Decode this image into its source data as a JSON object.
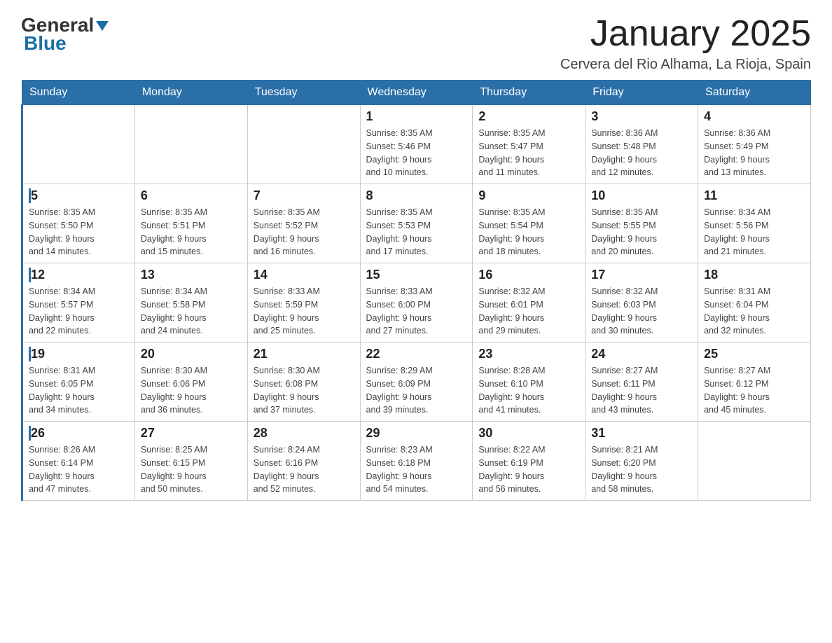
{
  "header": {
    "logo_main": "General",
    "logo_sub": "Blue",
    "month": "January 2025",
    "location": "Cervera del Rio Alhama, La Rioja, Spain"
  },
  "days_of_week": [
    "Sunday",
    "Monday",
    "Tuesday",
    "Wednesday",
    "Thursday",
    "Friday",
    "Saturday"
  ],
  "weeks": [
    [
      {
        "day": "",
        "info": ""
      },
      {
        "day": "",
        "info": ""
      },
      {
        "day": "",
        "info": ""
      },
      {
        "day": "1",
        "info": "Sunrise: 8:35 AM\nSunset: 5:46 PM\nDaylight: 9 hours\nand 10 minutes."
      },
      {
        "day": "2",
        "info": "Sunrise: 8:35 AM\nSunset: 5:47 PM\nDaylight: 9 hours\nand 11 minutes."
      },
      {
        "day": "3",
        "info": "Sunrise: 8:36 AM\nSunset: 5:48 PM\nDaylight: 9 hours\nand 12 minutes."
      },
      {
        "day": "4",
        "info": "Sunrise: 8:36 AM\nSunset: 5:49 PM\nDaylight: 9 hours\nand 13 minutes."
      }
    ],
    [
      {
        "day": "5",
        "info": "Sunrise: 8:35 AM\nSunset: 5:50 PM\nDaylight: 9 hours\nand 14 minutes."
      },
      {
        "day": "6",
        "info": "Sunrise: 8:35 AM\nSunset: 5:51 PM\nDaylight: 9 hours\nand 15 minutes."
      },
      {
        "day": "7",
        "info": "Sunrise: 8:35 AM\nSunset: 5:52 PM\nDaylight: 9 hours\nand 16 minutes."
      },
      {
        "day": "8",
        "info": "Sunrise: 8:35 AM\nSunset: 5:53 PM\nDaylight: 9 hours\nand 17 minutes."
      },
      {
        "day": "9",
        "info": "Sunrise: 8:35 AM\nSunset: 5:54 PM\nDaylight: 9 hours\nand 18 minutes."
      },
      {
        "day": "10",
        "info": "Sunrise: 8:35 AM\nSunset: 5:55 PM\nDaylight: 9 hours\nand 20 minutes."
      },
      {
        "day": "11",
        "info": "Sunrise: 8:34 AM\nSunset: 5:56 PM\nDaylight: 9 hours\nand 21 minutes."
      }
    ],
    [
      {
        "day": "12",
        "info": "Sunrise: 8:34 AM\nSunset: 5:57 PM\nDaylight: 9 hours\nand 22 minutes."
      },
      {
        "day": "13",
        "info": "Sunrise: 8:34 AM\nSunset: 5:58 PM\nDaylight: 9 hours\nand 24 minutes."
      },
      {
        "day": "14",
        "info": "Sunrise: 8:33 AM\nSunset: 5:59 PM\nDaylight: 9 hours\nand 25 minutes."
      },
      {
        "day": "15",
        "info": "Sunrise: 8:33 AM\nSunset: 6:00 PM\nDaylight: 9 hours\nand 27 minutes."
      },
      {
        "day": "16",
        "info": "Sunrise: 8:32 AM\nSunset: 6:01 PM\nDaylight: 9 hours\nand 29 minutes."
      },
      {
        "day": "17",
        "info": "Sunrise: 8:32 AM\nSunset: 6:03 PM\nDaylight: 9 hours\nand 30 minutes."
      },
      {
        "day": "18",
        "info": "Sunrise: 8:31 AM\nSunset: 6:04 PM\nDaylight: 9 hours\nand 32 minutes."
      }
    ],
    [
      {
        "day": "19",
        "info": "Sunrise: 8:31 AM\nSunset: 6:05 PM\nDaylight: 9 hours\nand 34 minutes."
      },
      {
        "day": "20",
        "info": "Sunrise: 8:30 AM\nSunset: 6:06 PM\nDaylight: 9 hours\nand 36 minutes."
      },
      {
        "day": "21",
        "info": "Sunrise: 8:30 AM\nSunset: 6:08 PM\nDaylight: 9 hours\nand 37 minutes."
      },
      {
        "day": "22",
        "info": "Sunrise: 8:29 AM\nSunset: 6:09 PM\nDaylight: 9 hours\nand 39 minutes."
      },
      {
        "day": "23",
        "info": "Sunrise: 8:28 AM\nSunset: 6:10 PM\nDaylight: 9 hours\nand 41 minutes."
      },
      {
        "day": "24",
        "info": "Sunrise: 8:27 AM\nSunset: 6:11 PM\nDaylight: 9 hours\nand 43 minutes."
      },
      {
        "day": "25",
        "info": "Sunrise: 8:27 AM\nSunset: 6:12 PM\nDaylight: 9 hours\nand 45 minutes."
      }
    ],
    [
      {
        "day": "26",
        "info": "Sunrise: 8:26 AM\nSunset: 6:14 PM\nDaylight: 9 hours\nand 47 minutes."
      },
      {
        "day": "27",
        "info": "Sunrise: 8:25 AM\nSunset: 6:15 PM\nDaylight: 9 hours\nand 50 minutes."
      },
      {
        "day": "28",
        "info": "Sunrise: 8:24 AM\nSunset: 6:16 PM\nDaylight: 9 hours\nand 52 minutes."
      },
      {
        "day": "29",
        "info": "Sunrise: 8:23 AM\nSunset: 6:18 PM\nDaylight: 9 hours\nand 54 minutes."
      },
      {
        "day": "30",
        "info": "Sunrise: 8:22 AM\nSunset: 6:19 PM\nDaylight: 9 hours\nand 56 minutes."
      },
      {
        "day": "31",
        "info": "Sunrise: 8:21 AM\nSunset: 6:20 PM\nDaylight: 9 hours\nand 58 minutes."
      },
      {
        "day": "",
        "info": ""
      }
    ]
  ]
}
